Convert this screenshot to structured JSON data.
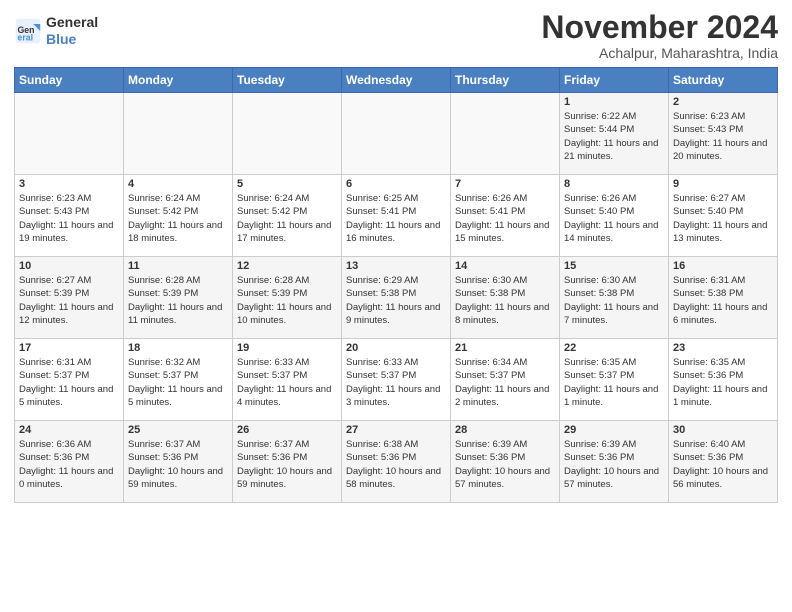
{
  "header": {
    "logo_line1": "General",
    "logo_line2": "Blue",
    "month": "November 2024",
    "location": "Achalpur, Maharashtra, India"
  },
  "weekdays": [
    "Sunday",
    "Monday",
    "Tuesday",
    "Wednesday",
    "Thursday",
    "Friday",
    "Saturday"
  ],
  "weeks": [
    [
      {
        "day": "",
        "info": ""
      },
      {
        "day": "",
        "info": ""
      },
      {
        "day": "",
        "info": ""
      },
      {
        "day": "",
        "info": ""
      },
      {
        "day": "",
        "info": ""
      },
      {
        "day": "1",
        "info": "Sunrise: 6:22 AM\nSunset: 5:44 PM\nDaylight: 11 hours and 21 minutes."
      },
      {
        "day": "2",
        "info": "Sunrise: 6:23 AM\nSunset: 5:43 PM\nDaylight: 11 hours and 20 minutes."
      }
    ],
    [
      {
        "day": "3",
        "info": "Sunrise: 6:23 AM\nSunset: 5:43 PM\nDaylight: 11 hours and 19 minutes."
      },
      {
        "day": "4",
        "info": "Sunrise: 6:24 AM\nSunset: 5:42 PM\nDaylight: 11 hours and 18 minutes."
      },
      {
        "day": "5",
        "info": "Sunrise: 6:24 AM\nSunset: 5:42 PM\nDaylight: 11 hours and 17 minutes."
      },
      {
        "day": "6",
        "info": "Sunrise: 6:25 AM\nSunset: 5:41 PM\nDaylight: 11 hours and 16 minutes."
      },
      {
        "day": "7",
        "info": "Sunrise: 6:26 AM\nSunset: 5:41 PM\nDaylight: 11 hours and 15 minutes."
      },
      {
        "day": "8",
        "info": "Sunrise: 6:26 AM\nSunset: 5:40 PM\nDaylight: 11 hours and 14 minutes."
      },
      {
        "day": "9",
        "info": "Sunrise: 6:27 AM\nSunset: 5:40 PM\nDaylight: 11 hours and 13 minutes."
      }
    ],
    [
      {
        "day": "10",
        "info": "Sunrise: 6:27 AM\nSunset: 5:39 PM\nDaylight: 11 hours and 12 minutes."
      },
      {
        "day": "11",
        "info": "Sunrise: 6:28 AM\nSunset: 5:39 PM\nDaylight: 11 hours and 11 minutes."
      },
      {
        "day": "12",
        "info": "Sunrise: 6:28 AM\nSunset: 5:39 PM\nDaylight: 11 hours and 10 minutes."
      },
      {
        "day": "13",
        "info": "Sunrise: 6:29 AM\nSunset: 5:38 PM\nDaylight: 11 hours and 9 minutes."
      },
      {
        "day": "14",
        "info": "Sunrise: 6:30 AM\nSunset: 5:38 PM\nDaylight: 11 hours and 8 minutes."
      },
      {
        "day": "15",
        "info": "Sunrise: 6:30 AM\nSunset: 5:38 PM\nDaylight: 11 hours and 7 minutes."
      },
      {
        "day": "16",
        "info": "Sunrise: 6:31 AM\nSunset: 5:38 PM\nDaylight: 11 hours and 6 minutes."
      }
    ],
    [
      {
        "day": "17",
        "info": "Sunrise: 6:31 AM\nSunset: 5:37 PM\nDaylight: 11 hours and 5 minutes."
      },
      {
        "day": "18",
        "info": "Sunrise: 6:32 AM\nSunset: 5:37 PM\nDaylight: 11 hours and 5 minutes."
      },
      {
        "day": "19",
        "info": "Sunrise: 6:33 AM\nSunset: 5:37 PM\nDaylight: 11 hours and 4 minutes."
      },
      {
        "day": "20",
        "info": "Sunrise: 6:33 AM\nSunset: 5:37 PM\nDaylight: 11 hours and 3 minutes."
      },
      {
        "day": "21",
        "info": "Sunrise: 6:34 AM\nSunset: 5:37 PM\nDaylight: 11 hours and 2 minutes."
      },
      {
        "day": "22",
        "info": "Sunrise: 6:35 AM\nSunset: 5:37 PM\nDaylight: 11 hours and 1 minute."
      },
      {
        "day": "23",
        "info": "Sunrise: 6:35 AM\nSunset: 5:36 PM\nDaylight: 11 hours and 1 minute."
      }
    ],
    [
      {
        "day": "24",
        "info": "Sunrise: 6:36 AM\nSunset: 5:36 PM\nDaylight: 11 hours and 0 minutes."
      },
      {
        "day": "25",
        "info": "Sunrise: 6:37 AM\nSunset: 5:36 PM\nDaylight: 10 hours and 59 minutes."
      },
      {
        "day": "26",
        "info": "Sunrise: 6:37 AM\nSunset: 5:36 PM\nDaylight: 10 hours and 59 minutes."
      },
      {
        "day": "27",
        "info": "Sunrise: 6:38 AM\nSunset: 5:36 PM\nDaylight: 10 hours and 58 minutes."
      },
      {
        "day": "28",
        "info": "Sunrise: 6:39 AM\nSunset: 5:36 PM\nDaylight: 10 hours and 57 minutes."
      },
      {
        "day": "29",
        "info": "Sunrise: 6:39 AM\nSunset: 5:36 PM\nDaylight: 10 hours and 57 minutes."
      },
      {
        "day": "30",
        "info": "Sunrise: 6:40 AM\nSunset: 5:36 PM\nDaylight: 10 hours and 56 minutes."
      }
    ]
  ]
}
